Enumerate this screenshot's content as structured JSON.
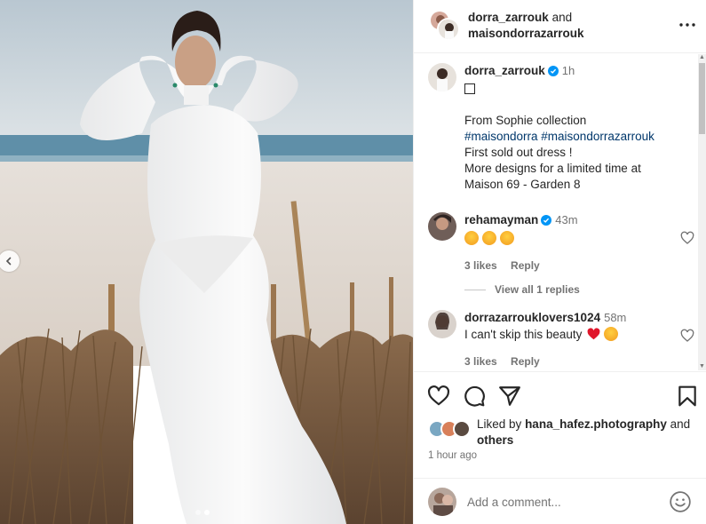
{
  "media": {
    "prev_icon": "chevron-left-icon",
    "slide_count": 2,
    "active_slide": 2
  },
  "header": {
    "user1": "dorra_zarrouk",
    "and_text": "and",
    "user2": "maisondorrazarrouk",
    "more_icon": "more-horizontal-icon"
  },
  "post": {
    "username": "dorra_zarrouk",
    "time": "1h",
    "emoji_line": "🤍",
    "lines": [
      "From Sophie collection"
    ],
    "hashtags": "#maisondorra #maisondorrazarrouk",
    "line3": "First sold out dress !",
    "line4": "More designs for a limited time at",
    "line5": "Maison 69 - Garden 8"
  },
  "comments": [
    {
      "username": "rehamayman",
      "verified": true,
      "time": "43m",
      "text": "🤩🤩🤩",
      "likes": "3 likes",
      "reply": "Reply"
    },
    {
      "username": "dorrazarrouklovers1024",
      "verified": false,
      "time": "58m",
      "text": "I can't skip this beauty ❤️🤩",
      "text_plain": "I can't skip this beauty",
      "likes": "3 likes",
      "reply": "Reply"
    }
  ],
  "view_replies": "View all 1 replies",
  "actions": {
    "like_icon": "heart-icon",
    "comment_icon": "comment-icon",
    "share_icon": "send-icon",
    "save_icon": "bookmark-icon"
  },
  "likes": {
    "prefix": "Liked by",
    "user": "hana_hafez.photography",
    "and": "and",
    "others": "others"
  },
  "timestamp": "1 hour ago",
  "comment_input": {
    "placeholder": "Add a comment...",
    "emoji_icon": "smiley-icon"
  },
  "colors": {
    "verified": "#0095f6",
    "hashtag": "#00376b",
    "secondary_text": "#737373",
    "text": "#262626"
  }
}
